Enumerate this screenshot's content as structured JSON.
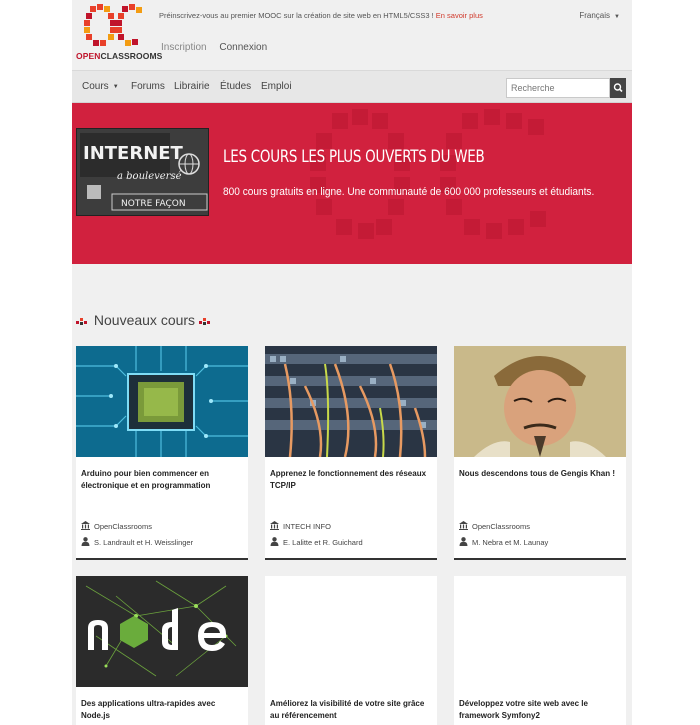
{
  "header": {
    "logo_part1": "OPEN",
    "logo_part2": "CLASSROOMS",
    "promo_text": "Préinscrivez-vous au premier MOOC sur la création de site web en HTML5/CSS3 !",
    "promo_link": "En savoir plus",
    "language": "Français",
    "signup": "Inscription",
    "login": "Connexion"
  },
  "nav": {
    "items": [
      "Cours",
      "Forums",
      "Librairie",
      "Études",
      "Emploi"
    ],
    "search_placeholder": "Recherche"
  },
  "hero": {
    "image_lines": [
      "INTERNET",
      "a bouleversé",
      "NOTRE FAÇON"
    ],
    "title": "LES COURS LES PLUS OUVERTS DU WEB",
    "subtitle": "800 cours gratuits en ligne. Une communauté de 600 000 professeurs et étudiants."
  },
  "section": {
    "title": "Nouveaux cours"
  },
  "courses": [
    {
      "title": "Arduino pour bien commencer en électronique et en programmation",
      "org": "OpenClassrooms",
      "authors": "S. Landrault et H. Weisslinger",
      "thumb": "circuit-chip"
    },
    {
      "title": "Apprenez le fonctionnement des réseaux TCP/IP",
      "org": "INTECH INFO",
      "authors": "E. Lalitte et R. Guichard",
      "thumb": "network-cables"
    },
    {
      "title": "Nous descendons tous de Gengis Khan !",
      "org": "OpenClassrooms",
      "authors": "M. Nebra et M. Launay",
      "thumb": "genghis-portrait"
    },
    {
      "title": "Des applications ultra-rapides avec Node.js",
      "thumb": "nodejs-logo"
    },
    {
      "title": "Améliorez la visibilité de votre site grâce au référencement",
      "thumb": "blank"
    },
    {
      "title": "Développez votre site web avec le framework Symfony2",
      "thumb": "blank"
    }
  ],
  "colors": {
    "brand_red": "#d1213e",
    "link_orange": "#d0392b",
    "nav_bg": "#e7e7e7"
  }
}
